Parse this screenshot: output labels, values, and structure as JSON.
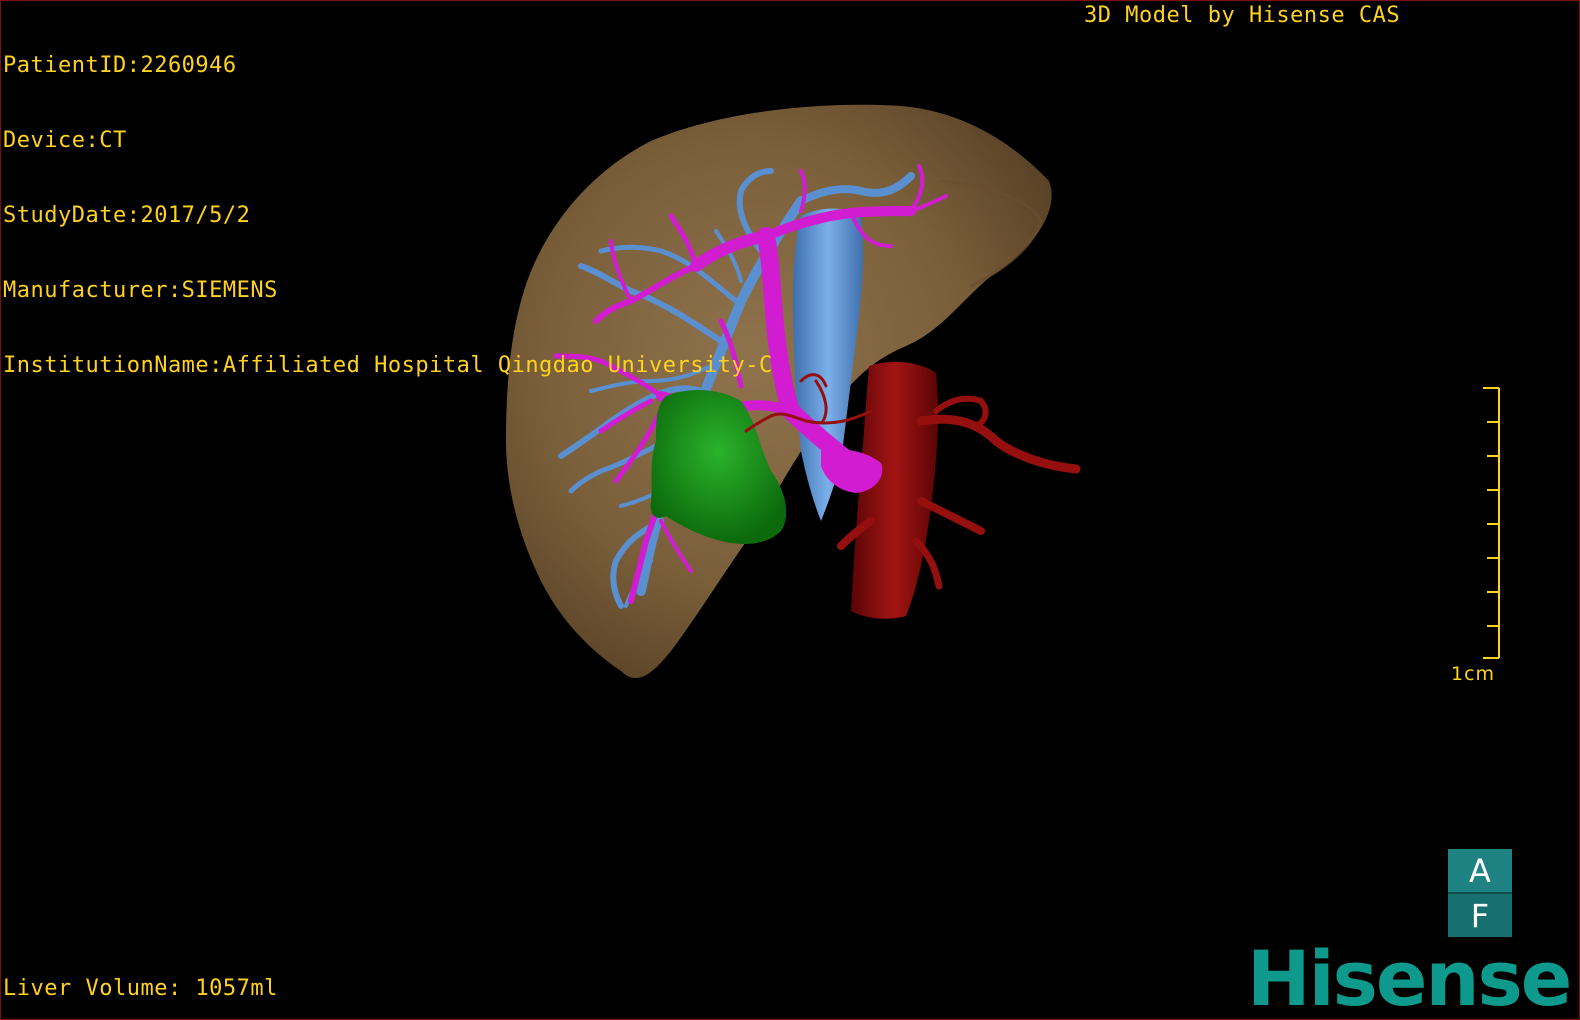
{
  "info": {
    "patient_id": "PatientID:2260946",
    "device": "Device:CT",
    "study_date": "StudyDate:2017/5/2",
    "manufacturer": "Manufacturer:SIEMENS",
    "institution": "InstitutionName:Affiliated Hospital Qingdao University-C"
  },
  "brand_credit": "3D Model by Hisense CAS",
  "liver_volume": "Liver Volume: 1057ml",
  "scale": {
    "label": "1cm"
  },
  "orientation": {
    "top_face": "A",
    "bottom_face": "F"
  },
  "logo": "Hisense",
  "colors": {
    "overlay_text": "#ffd21e",
    "liver": "#8a6d48",
    "portal_vein": "#d21cd2",
    "hepatic_vein": "#5a8fd0",
    "artery": "#8a0c0c",
    "tumor": "#1a8c1a",
    "logo": "#0d9a8c"
  },
  "icons": {
    "orientation_cube": "orientation-cube-icon",
    "scale_bar": "scale-bar-icon"
  }
}
